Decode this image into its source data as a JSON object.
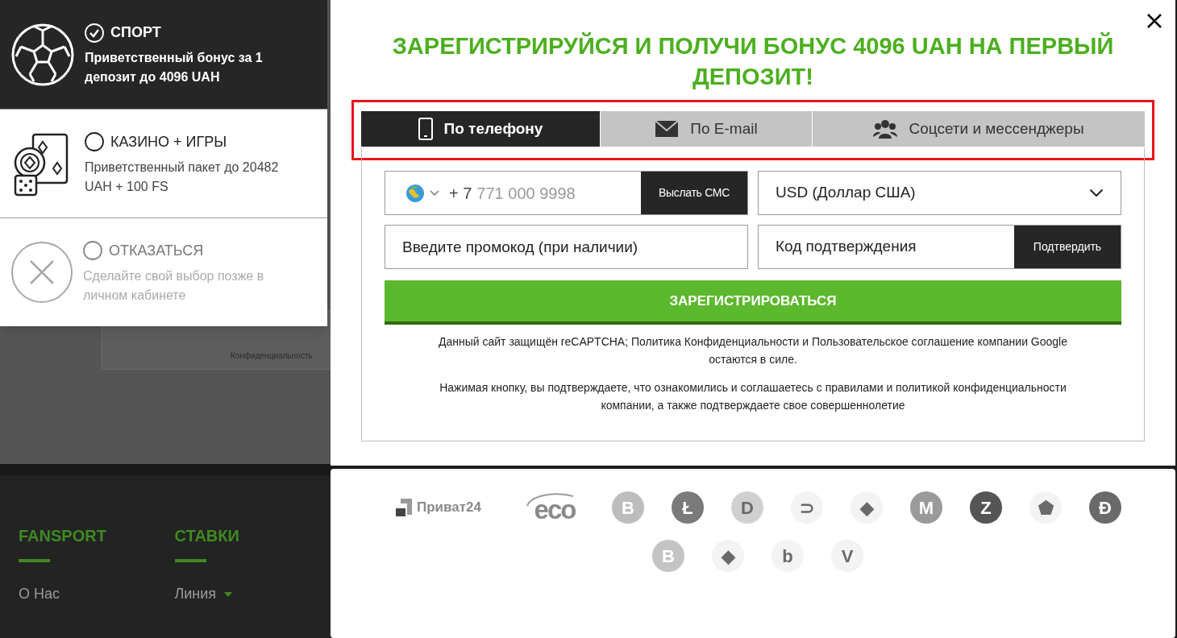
{
  "bonus_options": [
    {
      "kind": "sport",
      "title": "СПОРТ",
      "description": "Приветственный бонус за 1 депозит до 4096 UAH",
      "selected": true
    },
    {
      "kind": "casino",
      "title": "КАЗИНО + ИГРЫ",
      "description": "Приветственный пакет до 20482 UAH + 100 FS",
      "selected": false
    },
    {
      "kind": "decline",
      "title": "ОТКАЗАТЬСЯ",
      "description": "Сделайте свой выбор позже в личном кабинете",
      "selected": false
    }
  ],
  "background_page": {
    "captcha_footer": "Конфиденциальность",
    "footer_columns": [
      {
        "heading": "FANSPORT",
        "links": [
          {
            "label": "О Нас",
            "dropdown": false
          }
        ]
      },
      {
        "heading": "СТАВКИ",
        "links": [
          {
            "label": "Линия",
            "dropdown": true
          }
        ]
      }
    ]
  },
  "modal": {
    "title": "ЗАРЕГИСТРИРУЙСЯ И ПОЛУЧИ БОНУС 4096 UAH НА ПЕРВЫЙ ДЕПОЗИТ!",
    "tabs": [
      {
        "kind": "phone",
        "label": "По телефону",
        "selected": true
      },
      {
        "kind": "email",
        "label": "По E-mail",
        "selected": false
      },
      {
        "kind": "social",
        "label": "Соцсети и мессенджеры",
        "selected": false
      }
    ],
    "phone": {
      "code": "+ 7",
      "placeholder": "771 000 9998",
      "button": "Выслать СМС"
    },
    "currency": {
      "value": "USD (Доллар США)"
    },
    "promo": {
      "placeholder": "Введите промокод (при наличии)"
    },
    "confirmation": {
      "placeholder": "Код подтверждения",
      "button": "Подтвердить"
    },
    "register_button": "ЗАРЕГИСТРИРОВАТЬСЯ",
    "notes": [
      "Данный сайт защищён reCAPTCHA; Политика Конфиденциальности и Пользовательское соглашение компании Google остаются в силе.",
      "Нажимая кнопку, вы подтверждаете, что ознакомились и соглашаетесь с правилами и политикой конфиденциальности компании, а также подтверждаете свое совершеннолетие"
    ]
  },
  "payment_logos": [
    {
      "kind": "privat",
      "label": "Приват24"
    },
    {
      "kind": "eco",
      "label": "eco"
    },
    {
      "kind": "coin",
      "symbol": "B",
      "color": "#bdbdbd"
    },
    {
      "kind": "coin",
      "symbol": "Ł",
      "color": "#7a7a7a"
    },
    {
      "kind": "coin",
      "symbol": "D",
      "color": "#d0d0d0"
    },
    {
      "kind": "coin",
      "symbol": "⊃",
      "color": "#f3f3f3"
    },
    {
      "kind": "coin",
      "symbol": "◆",
      "color": "#f3f3f3"
    },
    {
      "kind": "coin",
      "symbol": "M",
      "color": "#9a9a9a"
    },
    {
      "kind": "coin",
      "symbol": "Z",
      "color": "#555555"
    },
    {
      "kind": "coin",
      "symbol": "⬟",
      "color": "#f3f3f3"
    },
    {
      "kind": "coin",
      "symbol": "Ð",
      "color": "#6a6a6a"
    },
    {
      "kind": "coin",
      "symbol": "B",
      "color": "#c4c4c4"
    },
    {
      "kind": "coin",
      "symbol": "◆",
      "color": "#f3f3f3"
    },
    {
      "kind": "coin",
      "symbol": "b",
      "color": "#f3f3f3"
    },
    {
      "kind": "coin",
      "symbol": "V",
      "color": "#f3f3f3"
    }
  ]
}
